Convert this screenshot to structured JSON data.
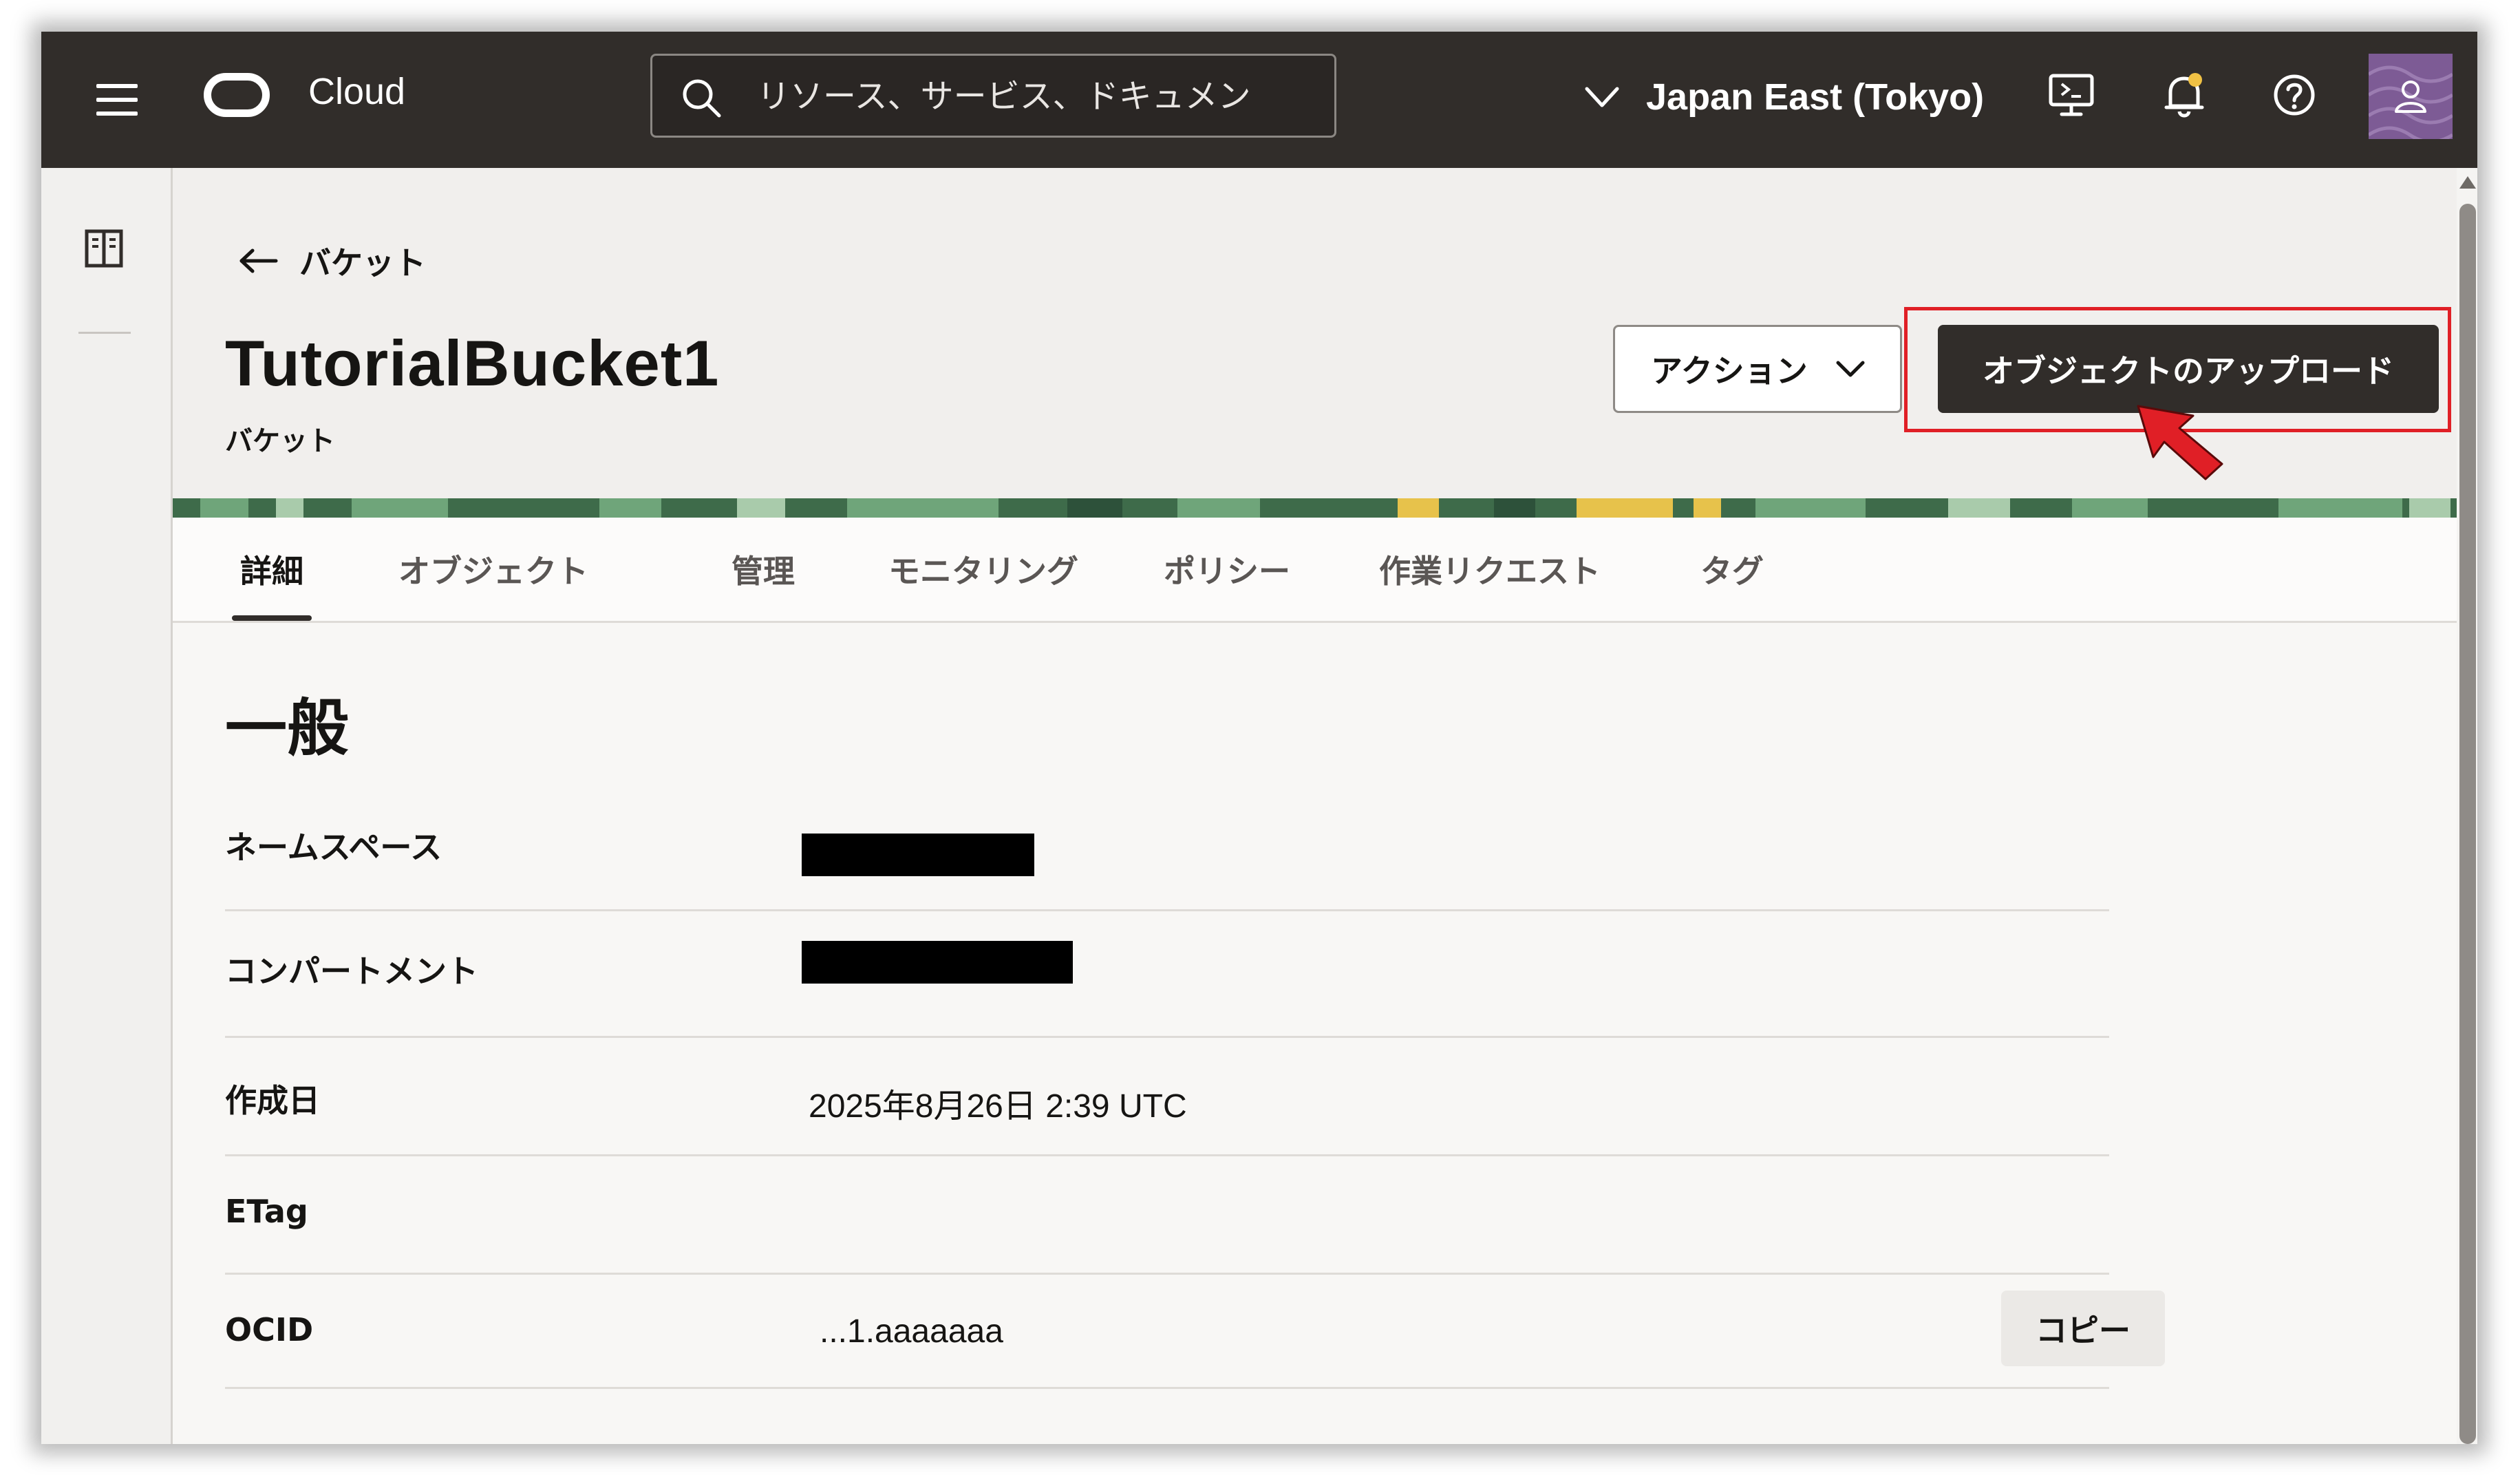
{
  "header": {
    "brand": "Cloud",
    "search_placeholder": "リソース、サービス、ドキュメン",
    "region": "Japan East (Tokyo)",
    "icons": [
      "hamburger-menu-icon",
      "oracle-logo",
      "search-icon",
      "chevron-down-icon",
      "cloud-shell-icon",
      "bell-icon",
      "help-icon",
      "user-avatar-icon"
    ]
  },
  "breadcrumb": {
    "back_label": "バケット"
  },
  "page": {
    "title": "TutorialBucket1",
    "subtitle": "バケット",
    "action_label": "アクション",
    "upload_label": "オブジェクトのアップロード"
  },
  "tabs": [
    "詳細",
    "オブジェクト",
    "管理",
    "モニタリング",
    "ポリシー",
    "作業リクエスト",
    "タグ"
  ],
  "active_tab": "詳細",
  "general": {
    "title": "一般",
    "rows": [
      {
        "label": "ネームスペース",
        "value": ""
      },
      {
        "label": "コンパートメント",
        "value": ""
      },
      {
        "label": "作成日",
        "value": "2025年8月26日 2:39 UTC"
      },
      {
        "label": "ETag",
        "value": ""
      },
      {
        "label": "OCID",
        "value": "...1.aaaaaaa"
      }
    ],
    "copy_label": "コピー"
  },
  "colors": {
    "header_bg": "#312d2a",
    "highlight": "#e01f26",
    "primary_button": "#312d2a"
  }
}
